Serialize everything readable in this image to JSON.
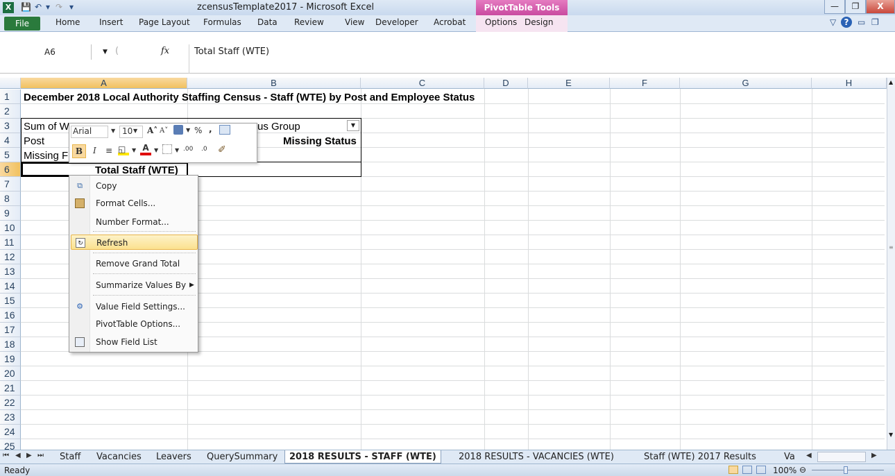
{
  "window": {
    "title": "zcensusTemplate2017  -  Microsoft Excel",
    "context_tab_group": "PivotTable Tools"
  },
  "ribbon": {
    "tabs": [
      "File",
      "Home",
      "Insert",
      "Page Layout",
      "Formulas",
      "Data",
      "Review",
      "View",
      "Developer",
      "Acrobat",
      "Options",
      "Design"
    ]
  },
  "formula_bar": {
    "name_box": "A6",
    "fx": "fx",
    "value": "Total Staff (WTE)"
  },
  "grid": {
    "columns": [
      "A",
      "B",
      "C",
      "D",
      "E",
      "F",
      "G",
      "H"
    ],
    "selected_column": "A",
    "rows": [
      "1",
      "2",
      "3",
      "4",
      "5",
      "6",
      "7",
      "8",
      "9",
      "10",
      "11",
      "12",
      "13",
      "14",
      "15",
      "16",
      "17",
      "18",
      "19",
      "20",
      "21",
      "22",
      "23",
      "24",
      "25"
    ],
    "selected_row": "6",
    "cells": {
      "a1": "December 2018 Local Authority Staffing Census - Staff (WTE) by Post and Employee Status",
      "a3": "Sum of W",
      "b3": "us Group",
      "a4": "Post",
      "c4": "Missing Status",
      "a5": "Missing F",
      "a6": "Total Staff (WTE)"
    }
  },
  "mini_toolbar": {
    "font": "Arial",
    "size": "10",
    "grow_font": "A˄",
    "shrink_font": "A˅",
    "percent": "%",
    "comma": ",",
    "bold": "B",
    "italic": "I",
    "font_color": "A",
    "inc_decimal": ".00",
    "dec_decimal": ".0"
  },
  "context_menu": {
    "items": [
      {
        "label": "Copy",
        "icon": "copy-icon"
      },
      {
        "label": "Format Cells...",
        "icon": "format-cells-icon"
      },
      {
        "label": "Number Format...",
        "icon": ""
      },
      {
        "label": "Refresh",
        "icon": "refresh-icon",
        "highlighted": true
      },
      {
        "label": "Remove Grand Total",
        "icon": ""
      },
      {
        "label": "Summarize Values By",
        "icon": "",
        "submenu": true
      },
      {
        "label": "Value Field Settings...",
        "icon": "value-field-settings-icon"
      },
      {
        "label": "PivotTable Options...",
        "icon": ""
      },
      {
        "label": "Show Field List",
        "icon": "field-list-icon"
      }
    ]
  },
  "sheet_tabs": {
    "tabs": [
      "Staff",
      "Vacancies",
      "Leavers",
      "QuerySummary",
      "2018 RESULTS - STAFF (WTE)",
      "2018 RESULTS - VACANCIES (WTE)",
      "Staff (WTE) 2017 Results",
      "Va"
    ],
    "active": "2018 RESULTS - STAFF (WTE)"
  },
  "status_bar": {
    "status": "Ready",
    "zoom": "100%"
  },
  "colors": {
    "title_bar": "#dfe9f5",
    "file_tab": "#2a7a3c",
    "pivot_tools": "#c94aa0",
    "selection_header": "#f1c15f",
    "menu_highlight": "#fbe18f"
  }
}
